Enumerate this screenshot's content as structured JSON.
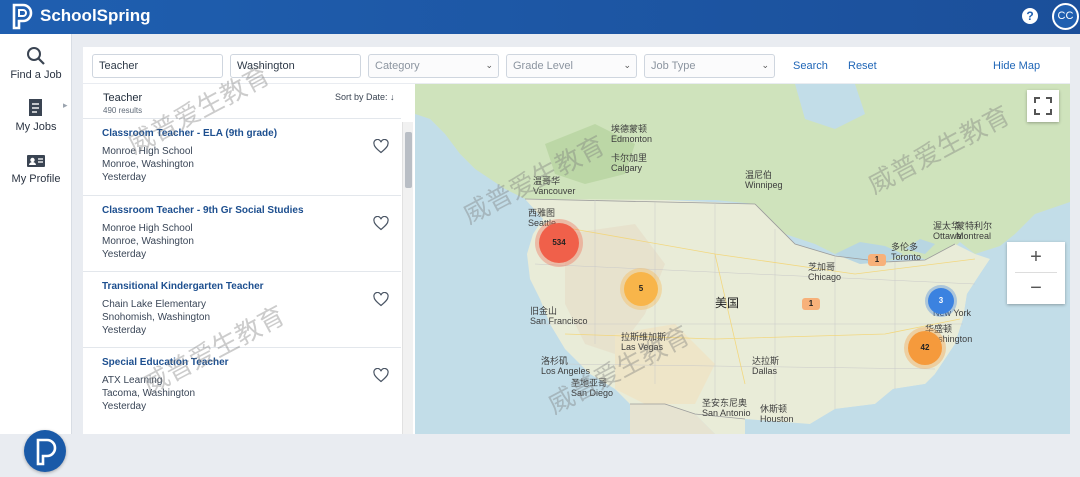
{
  "header": {
    "brand": "SchoolSpring",
    "help": "?",
    "avatar": "CC"
  },
  "nav": [
    {
      "label": "Find a Job",
      "icon": "search-icon"
    },
    {
      "label": "My Jobs",
      "icon": "document-icon"
    },
    {
      "label": "My Profile",
      "icon": "profile-card-icon"
    }
  ],
  "filters": {
    "keyword": "Teacher",
    "location": "Washington",
    "category_placeholder": "Category",
    "grade_placeholder": "Grade Level",
    "jobtype_placeholder": "Job Type",
    "search_label": "Search",
    "reset_label": "Reset",
    "hide_map_label": "Hide Map"
  },
  "results": {
    "title": "Teacher",
    "count": "490 results",
    "sort_label": "Sort by Date: ↓",
    "jobs": [
      {
        "title": "Classroom Teacher - ELA (9th grade)",
        "school": "Monroe High School",
        "location": "Monroe, Washington",
        "posted": "Yesterday"
      },
      {
        "title": "Classroom Teacher - 9th Gr Social Studies",
        "school": "Monroe High School",
        "location": "Monroe, Washington",
        "posted": "Yesterday"
      },
      {
        "title": "Transitional Kindergarten Teacher",
        "school": "Chain Lake Elementary",
        "location": "Snohomish, Washington",
        "posted": "Yesterday"
      },
      {
        "title": "Special Education Teacher",
        "school": "ATX Learning",
        "location": "Tacoma, Washington",
        "posted": "Yesterday"
      }
    ]
  },
  "map": {
    "country_label": "美国",
    "labels": {
      "edmonton": "埃德蒙顿\nEdmonton",
      "calgary": "卡尔加里\nCalgary",
      "vancouver": "温哥华\nVancouver",
      "seattle": "西雅图\nSeattle",
      "winnipeg": "温尼伯\nWinnipeg",
      "ottawa": "渥太华\nOttawa",
      "montreal": "蒙特利尔\nMontreal",
      "toronto": "多伦多\nToronto",
      "chicago": "芝加哥\nChicago",
      "new_york": "纽约\nNew York",
      "washington": "华盛顿\nWashington",
      "sf": "旧金山\nSan Francisco",
      "las_vegas": "拉斯维加斯\nLas Vegas",
      "la": "洛杉矶\nLos Angeles",
      "san_diego": "圣地亚哥\nSan Diego",
      "dallas": "达拉斯\nDallas",
      "houston": "休斯顿\nHouston",
      "san_antonio": "圣安东尼奥\nSan Antonio"
    },
    "clusters": [
      {
        "count": "534",
        "color": "#f0604a"
      },
      {
        "count": "5",
        "color": "#f8b54a"
      },
      {
        "count": "42",
        "color": "#f59a3c"
      },
      {
        "count": "3",
        "color": "#3b82e0"
      },
      {
        "count": "1",
        "color": "#f7b17a"
      },
      {
        "count": "1",
        "color": "#f7b17a"
      }
    ],
    "zoom_in": "+",
    "zoom_out": "−"
  },
  "watermark": "威普爱生教育"
}
